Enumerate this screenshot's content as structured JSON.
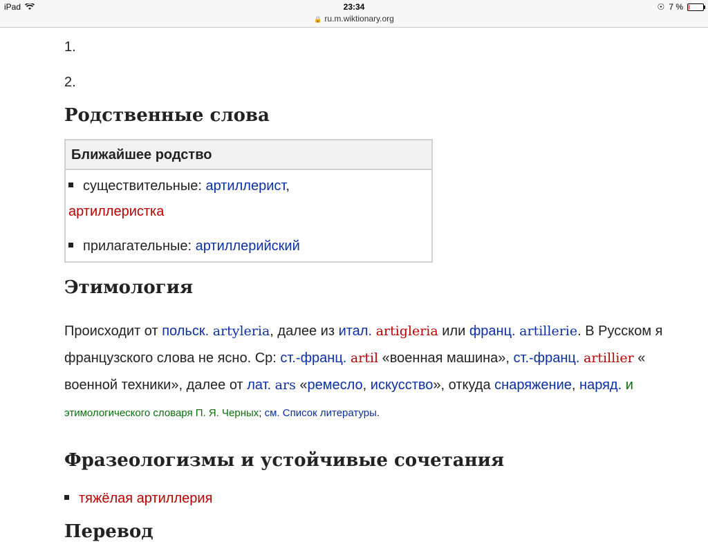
{
  "status_bar": {
    "device": "iPad",
    "time": "23:34",
    "url": "ru.m.wiktionary.org",
    "battery": "7 %",
    "battery_level": 0.07
  },
  "meanings": [
    "1.",
    "2."
  ],
  "related": {
    "heading": "Родственные слова",
    "box_title": "Ближайшее родство",
    "nouns_label": "существительные:",
    "noun1": "артиллерист",
    "comma": ",",
    "noun2": "артиллеристка",
    "adj_label": "прилагательные:",
    "adj1": "артиллерийский"
  },
  "etymology": {
    "heading": "Этимология",
    "l1": {
      "t1": "Происходит от ",
      "a1": "польск.",
      "w1": "artyleria",
      "t2": ", далее из ",
      "a2": "итал.",
      "w2": "artigleria",
      "t3": " или ",
      "a3": "франц.",
      "w3": "artillerie",
      "t4": ". В Русском я"
    },
    "l2": {
      "t1": "французского слова не ясно. Ср: ",
      "a1": "ст.-франц.",
      "w1": "artil",
      "t2": " «военная машина», ",
      "a2": "ст.-франц.",
      "w2": "artillier",
      "t3": " «"
    },
    "l3": {
      "t1": "военной техники», далее от ",
      "a1": "лат.",
      "w1": "ars",
      "t2": " «",
      "k1": "ремесло",
      "t3": ", ",
      "k2": "искусство",
      "t4": "», откуда ",
      "k3": "снаряжение",
      "t5": ", ",
      "k4": "наряд.",
      "t6": " и"
    },
    "l4": {
      "src": "этимологического словаря П. Я. Черных",
      "sep": "; ",
      "see": "см. Список литературы",
      "end": "."
    }
  },
  "phrases": {
    "heading": "Фразеологизмы и устойчивые сочетания",
    "item1": "тяжёлая артиллерия"
  },
  "next_heading": "Перевод"
}
